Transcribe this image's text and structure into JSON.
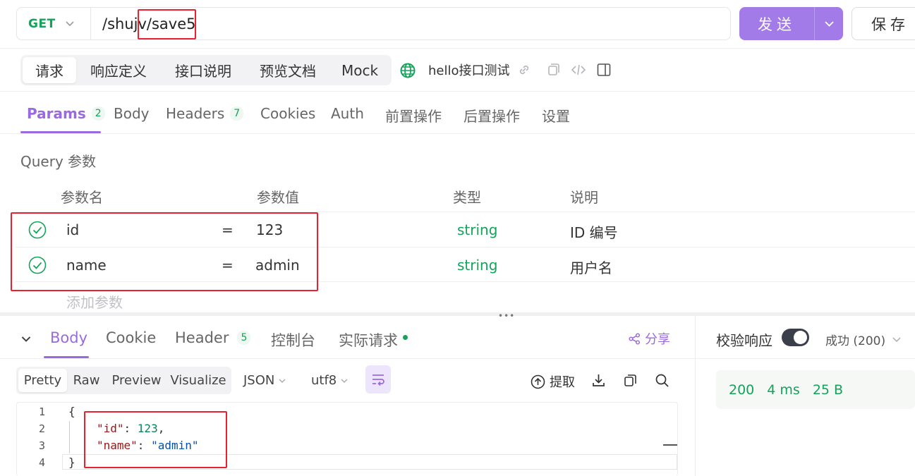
{
  "request": {
    "method": "GET",
    "url": "/shujv/save5",
    "send_label": "发送",
    "save_label": "保存"
  },
  "top_tabs": [
    {
      "label": "请求",
      "active": true
    },
    {
      "label": "响应定义",
      "active": false
    },
    {
      "label": "接口说明",
      "active": false
    },
    {
      "label": "预览文档",
      "active": false
    },
    {
      "label": "Mock",
      "active": false
    }
  ],
  "api_name": "hello接口测试",
  "param_tabs": [
    {
      "label": "Params",
      "badge": "2",
      "active": true
    },
    {
      "label": "Body",
      "badge": "",
      "active": false
    },
    {
      "label": "Headers",
      "badge": "7",
      "active": false
    },
    {
      "label": "Cookies",
      "badge": "",
      "active": false
    },
    {
      "label": "Auth",
      "badge": "",
      "active": false
    },
    {
      "label": "前置操作",
      "badge": "",
      "active": false
    },
    {
      "label": "后置操作",
      "badge": "",
      "active": false
    },
    {
      "label": "设置",
      "badge": "",
      "active": false
    }
  ],
  "query": {
    "title": "Query 参数",
    "headers": {
      "name": "参数名",
      "value": "参数值",
      "type": "类型",
      "desc": "说明"
    },
    "rows": [
      {
        "name": "id",
        "eq": "=",
        "value": "123",
        "type": "string",
        "desc": "ID 编号"
      },
      {
        "name": "name",
        "eq": "=",
        "value": "admin",
        "type": "string",
        "desc": "用户名"
      }
    ],
    "add_label": "添加参数"
  },
  "response_tabs": [
    {
      "label": "Body",
      "badge": "",
      "active": true
    },
    {
      "label": "Cookie",
      "badge": "",
      "active": false
    },
    {
      "label": "Header",
      "badge": "5",
      "active": false
    },
    {
      "label": "控制台",
      "badge": "",
      "active": false
    },
    {
      "label": "实际请求",
      "badge": "",
      "active": false
    }
  ],
  "share_label": "分享",
  "format_tabs": [
    {
      "label": "Pretty",
      "active": true
    },
    {
      "label": "Raw",
      "active": false
    },
    {
      "label": "Preview",
      "active": false
    },
    {
      "label": "Visualize",
      "active": false
    }
  ],
  "format_select": "JSON",
  "encoding_select": "utf8",
  "extract_label": "提取",
  "code": {
    "line_numbers": [
      "1",
      "2",
      "3",
      "4"
    ],
    "open_brace": "{",
    "close_brace": "}",
    "id_key": "\"id\"",
    "id_value": "123",
    "name_key": "\"name\"",
    "name_value": "\"admin\""
  },
  "verify": {
    "label": "校验响应",
    "enabled": true,
    "status_select": "成功 (200)"
  },
  "response_meta": {
    "status": "200",
    "time": "4 ms",
    "size": "25 B"
  },
  "colors": {
    "accent": "#9a6ae0",
    "send_button": "#a37be8",
    "success": "#14a35a",
    "highlight_box": "#e8222e"
  }
}
